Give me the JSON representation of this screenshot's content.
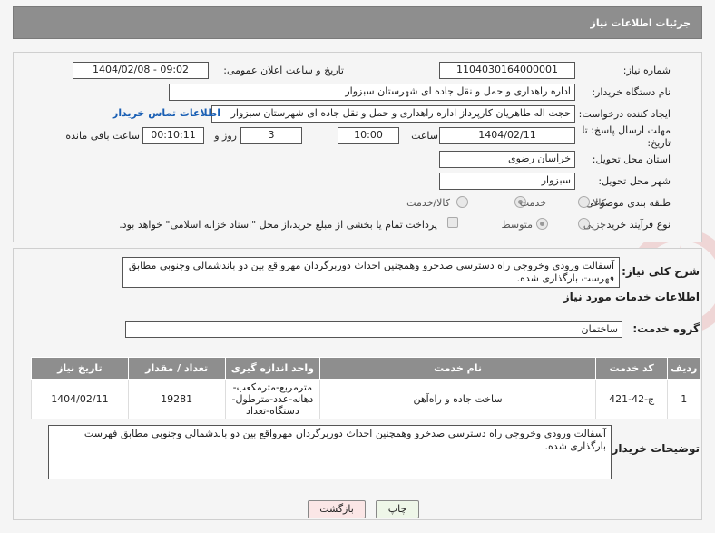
{
  "header": {
    "title": "جزئیات اطلاعات نیاز"
  },
  "info": {
    "need_number_label": "شماره نیاز:",
    "need_number": "1104030164000001",
    "announce_label": "تاریخ و ساعت اعلان عمومی:",
    "announce_value": "1404/02/08 - 09:02",
    "buyer_org_label": "نام دستگاه خریدار:",
    "buyer_org": "اداره راهداری و حمل و نقل جاده ای شهرستان سبزوار",
    "creator_label": "ایجاد کننده درخواست:",
    "creator": "حجت اله طاهریان کارپرداز اداره راهداری و حمل و نقل جاده ای شهرستان سبزوار",
    "contact_link": "اطلاعات تماس خریدار",
    "deadline_label_1": "مهلت ارسال پاسخ: تا",
    "deadline_label_2": "تاریخ:",
    "deadline_date": "1404/02/11",
    "time_label": "ساعت",
    "deadline_time": "10:00",
    "days_value": "3",
    "days_label": "روز و",
    "remaining_time": "00:10:11",
    "remaining_label": "ساعت باقی مانده",
    "province_label": "استان محل تحویل:",
    "province": "خراسان رضوی",
    "city_label": "شهر محل تحویل:",
    "city": "سبزوار",
    "category_label": "طبقه بندی موضوعی:",
    "category_options": [
      "کالا",
      "خدمت",
      "کالا/خدمت"
    ],
    "category_selected": "خدمت",
    "process_label": "نوع فرآیند خرید :",
    "process_options": [
      "جزیی",
      "متوسط"
    ],
    "process_selected": "متوسط",
    "payment_note": "پرداخت تمام یا بخشی از مبلغ خرید،از محل \"اسناد خزانه اسلامی\" خواهد بود."
  },
  "summary": {
    "label": "شرح کلی نیاز:",
    "text": "آسفالت ورودی وخروجی راه دسترسی صدخرو  وهمچنین احداث دوربرگردان مهرواقع بین دو باندشمالی وجنوبی مطابق فهرست بارگذاری شده."
  },
  "services": {
    "section_title": "اطلاعات خدمات مورد نیاز",
    "group_label": "گروه خدمت:",
    "group_value": "ساختمان",
    "columns": [
      "ردیف",
      "کد خدمت",
      "نام خدمت",
      "واحد اندازه گیری",
      "تعداد / مقدار",
      "تاریخ نیاز"
    ],
    "rows": [
      {
        "index": "1",
        "code": "ج-42-421",
        "name": "ساخت جاده و راه‌آهن",
        "unit": "مترمربع-مترمکعب-دهانه-عدد-مترطول-دستگاه-تعداد",
        "qty": "19281",
        "date": "1404/02/11"
      }
    ]
  },
  "buyer_notes": {
    "label": "توضیحات خریدار:",
    "text": "آسفالت ورودی وخروجی راه دسترسی صدخرو  وهمچنین احداث دوربرگردان مهرواقع بین دو باندشمالی وجنوبی مطابق فهرست بارگذاری شده."
  },
  "buttons": {
    "print": "چاپ",
    "back": "بازگشت"
  },
  "colors": {
    "header_bg": "#8e8e8e",
    "link": "#1a5fb4",
    "watermark": "#e9c9c9"
  }
}
